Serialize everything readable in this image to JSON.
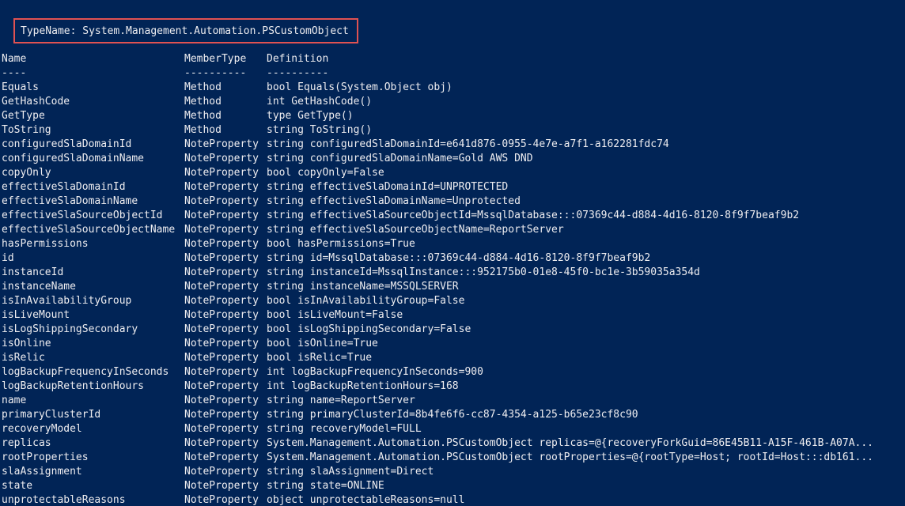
{
  "console": {
    "type_name_line": "TypeName: System.Management.Automation.PSCustomObject"
  },
  "table": {
    "headers": {
      "name": "Name",
      "member_type": "MemberType",
      "definition": "Definition"
    },
    "separators": {
      "name": "----",
      "member_type": "----------",
      "definition": "----------"
    },
    "rows": [
      {
        "name": "Equals",
        "member_type": "Method",
        "definition": "bool Equals(System.Object obj)"
      },
      {
        "name": "GetHashCode",
        "member_type": "Method",
        "definition": "int GetHashCode()"
      },
      {
        "name": "GetType",
        "member_type": "Method",
        "definition": "type GetType()"
      },
      {
        "name": "ToString",
        "member_type": "Method",
        "definition": "string ToString()"
      },
      {
        "name": "configuredSlaDomainId",
        "member_type": "NoteProperty",
        "definition": "string configuredSlaDomainId=e641d876-0955-4e7e-a7f1-a162281fdc74"
      },
      {
        "name": "configuredSlaDomainName",
        "member_type": "NoteProperty",
        "definition": "string configuredSlaDomainName=Gold AWS DND"
      },
      {
        "name": "copyOnly",
        "member_type": "NoteProperty",
        "definition": "bool copyOnly=False"
      },
      {
        "name": "effectiveSlaDomainId",
        "member_type": "NoteProperty",
        "definition": "string effectiveSlaDomainId=UNPROTECTED"
      },
      {
        "name": "effectiveSlaDomainName",
        "member_type": "NoteProperty",
        "definition": "string effectiveSlaDomainName=Unprotected"
      },
      {
        "name": "effectiveSlaSourceObjectId",
        "member_type": "NoteProperty",
        "definition": "string effectiveSlaSourceObjectId=MssqlDatabase:::07369c44-d884-4d16-8120-8f9f7beaf9b2"
      },
      {
        "name": "effectiveSlaSourceObjectName",
        "member_type": "NoteProperty",
        "definition": "string effectiveSlaSourceObjectName=ReportServer"
      },
      {
        "name": "hasPermissions",
        "member_type": "NoteProperty",
        "definition": "bool hasPermissions=True"
      },
      {
        "name": "id",
        "member_type": "NoteProperty",
        "definition": "string id=MssqlDatabase:::07369c44-d884-4d16-8120-8f9f7beaf9b2"
      },
      {
        "name": "instanceId",
        "member_type": "NoteProperty",
        "definition": "string instanceId=MssqlInstance:::952175b0-01e8-45f0-bc1e-3b59035a354d"
      },
      {
        "name": "instanceName",
        "member_type": "NoteProperty",
        "definition": "string instanceName=MSSQLSERVER"
      },
      {
        "name": "isInAvailabilityGroup",
        "member_type": "NoteProperty",
        "definition": "bool isInAvailabilityGroup=False"
      },
      {
        "name": "isLiveMount",
        "member_type": "NoteProperty",
        "definition": "bool isLiveMount=False"
      },
      {
        "name": "isLogShippingSecondary",
        "member_type": "NoteProperty",
        "definition": "bool isLogShippingSecondary=False"
      },
      {
        "name": "isOnline",
        "member_type": "NoteProperty",
        "definition": "bool isOnline=True"
      },
      {
        "name": "isRelic",
        "member_type": "NoteProperty",
        "definition": "bool isRelic=True"
      },
      {
        "name": "logBackupFrequencyInSeconds",
        "member_type": "NoteProperty",
        "definition": "int logBackupFrequencyInSeconds=900"
      },
      {
        "name": "logBackupRetentionHours",
        "member_type": "NoteProperty",
        "definition": "int logBackupRetentionHours=168"
      },
      {
        "name": "name",
        "member_type": "NoteProperty",
        "definition": "string name=ReportServer"
      },
      {
        "name": "primaryClusterId",
        "member_type": "NoteProperty",
        "definition": "string primaryClusterId=8b4fe6f6-cc87-4354-a125-b65e23cf8c90"
      },
      {
        "name": "recoveryModel",
        "member_type": "NoteProperty",
        "definition": "string recoveryModel=FULL"
      },
      {
        "name": "replicas",
        "member_type": "NoteProperty",
        "definition": "System.Management.Automation.PSCustomObject replicas=@{recoveryForkGuid=86E45B11-A15F-461B-A07A..."
      },
      {
        "name": "rootProperties",
        "member_type": "NoteProperty",
        "definition": "System.Management.Automation.PSCustomObject rootProperties=@{rootType=Host; rootId=Host:::db161..."
      },
      {
        "name": "slaAssignment",
        "member_type": "NoteProperty",
        "definition": "string slaAssignment=Direct"
      },
      {
        "name": "state",
        "member_type": "NoteProperty",
        "definition": "string state=ONLINE"
      },
      {
        "name": "unprotectableReasons",
        "member_type": "NoteProperty",
        "definition": "object unprotectableReasons=null"
      }
    ]
  }
}
